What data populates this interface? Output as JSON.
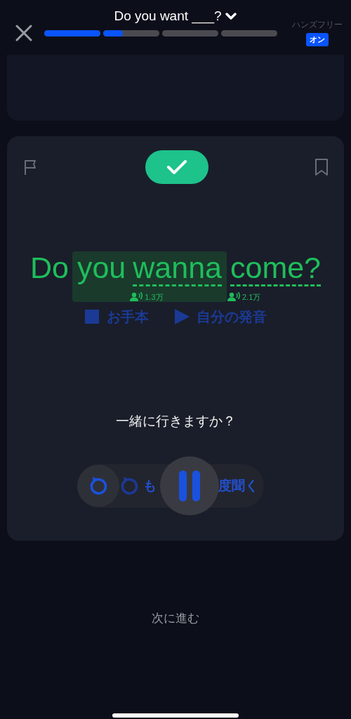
{
  "header": {
    "title": "Do you want ___?",
    "progress": [
      {
        "level": 1
      },
      {
        "level": 0.35
      },
      {
        "level": 0
      },
      {
        "level": 0
      }
    ],
    "hands_free": {
      "label": "ハンズフリー",
      "badge": "オン",
      "on": true
    }
  },
  "card": {
    "correct": true,
    "words": [
      {
        "text": "Do",
        "highlighted": false,
        "underlined": false
      },
      {
        "text": "you",
        "highlighted": true,
        "underlined": false
      },
      {
        "text": "wanna",
        "highlighted": true,
        "underlined": true,
        "count": "1.3万"
      },
      {
        "text": "come?",
        "highlighted": false,
        "underlined": true,
        "count": "2.1万"
      }
    ],
    "audio_buttons": [
      {
        "label": "お手本",
        "kind": "stop"
      },
      {
        "label": "自分の発音",
        "kind": "play"
      }
    ],
    "translation": "一緒に行きますか？",
    "replay": {
      "text_parts": [
        "も",
        "度聞く"
      ]
    }
  },
  "next_label": "次に進む"
}
